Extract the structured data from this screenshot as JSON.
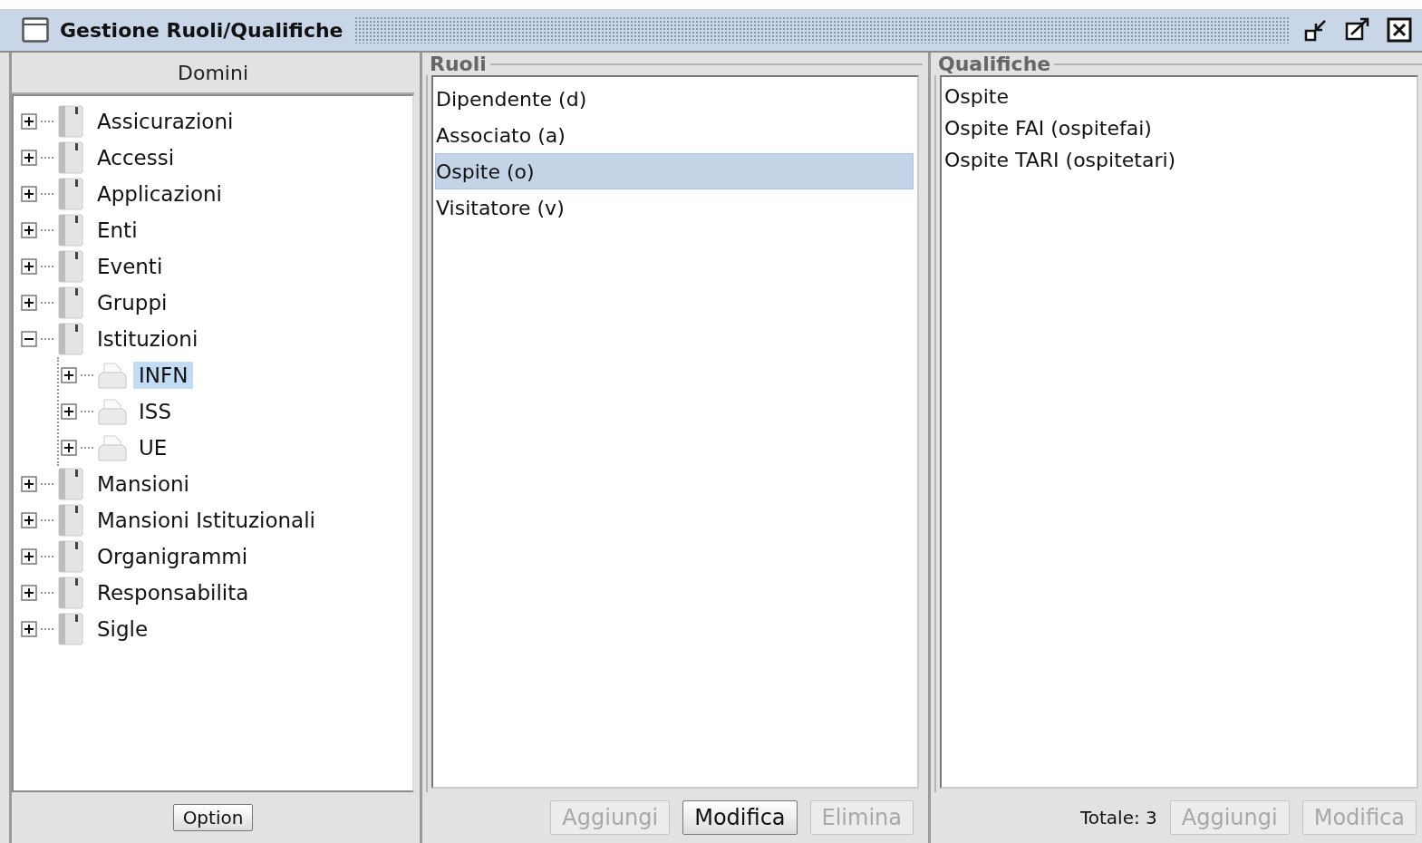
{
  "window": {
    "title": "Gestione Ruoli/Qualifiche"
  },
  "domains": {
    "header": "Domini",
    "tree": [
      {
        "label": "Assicurazioni",
        "expanded": false,
        "selected": false
      },
      {
        "label": "Accessi",
        "expanded": false,
        "selected": false
      },
      {
        "label": "Applicazioni",
        "expanded": false,
        "selected": false
      },
      {
        "label": "Enti",
        "expanded": false,
        "selected": false
      },
      {
        "label": "Eventi",
        "expanded": false,
        "selected": false
      },
      {
        "label": "Gruppi",
        "expanded": false,
        "selected": false
      },
      {
        "label": "Istituzioni",
        "expanded": true,
        "selected": false,
        "children": [
          {
            "label": "INFN",
            "expanded": false,
            "selected": true
          },
          {
            "label": "ISS",
            "expanded": false,
            "selected": false
          },
          {
            "label": "UE",
            "expanded": false,
            "selected": false
          }
        ]
      },
      {
        "label": "Mansioni",
        "expanded": false,
        "selected": false
      },
      {
        "label": "Mansioni Istituzionali",
        "expanded": false,
        "selected": false
      },
      {
        "label": "Organigrammi",
        "expanded": false,
        "selected": false
      },
      {
        "label": "Responsabilita",
        "expanded": false,
        "selected": false
      },
      {
        "label": "Sigle",
        "expanded": false,
        "selected": false
      }
    ],
    "buttons": [
      {
        "label": "Option",
        "disabled": false
      }
    ]
  },
  "roles": {
    "title": "Ruoli",
    "items": [
      {
        "label": "Dipendente (d)",
        "selected": false
      },
      {
        "label": "Associato (a)",
        "selected": false
      },
      {
        "label": "Ospite (o)",
        "selected": true
      },
      {
        "label": "Visitatore (v)",
        "selected": false
      }
    ],
    "buttons": [
      {
        "label": "Aggiungi",
        "disabled": true
      },
      {
        "label": "Modifica",
        "disabled": false
      },
      {
        "label": "Elimina",
        "disabled": true
      }
    ]
  },
  "qualifications": {
    "title": "Qualifiche",
    "items": [
      {
        "label": "Ospite",
        "selected": false
      },
      {
        "label": "Ospite FAI (ospitefai)",
        "selected": false
      },
      {
        "label": "Ospite TARI (ospitetari)",
        "selected": false
      }
    ],
    "total": "Totale: 3",
    "buttons": [
      {
        "label": "Aggiungi",
        "disabled": true
      },
      {
        "label": "Modifica",
        "disabled": true
      }
    ]
  }
}
